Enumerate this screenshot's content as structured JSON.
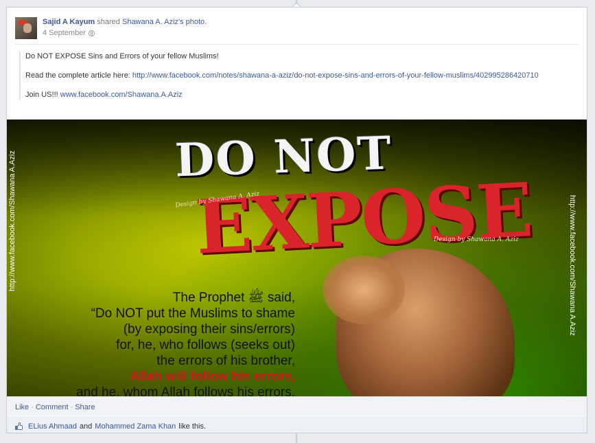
{
  "post": {
    "author": "Sajid A Kayum",
    "action_text": "shared",
    "owner_link": "Shawana A. Aziz",
    "owner_suffix": "'s photo.",
    "date": "4 September"
  },
  "message": {
    "line1": "Do NOT EXPOSE Sins and Errors of your fellow Muslims!",
    "line2_prefix": "Read the complete article here: ",
    "line2_link": "http://www.facebook.com/notes/shawana-a-aziz/do-not-expose-sins-and-errors-of-your-fellow-muslims/402995286420710",
    "line3_prefix": "Join US!!! ",
    "line3_link": "www.facebook.com/Shawana.A.Aziz"
  },
  "photo": {
    "title_top": "DO NOT",
    "title_main": "EXPOSE",
    "credit_left": "Design by Shawana A. Aziz",
    "credit_right": "Design by Shawana A. Aziz",
    "side_left": "http://www.facebook.com/Shawana A.Aziz",
    "side_right": "http://www.facebook.com/Shawana A.Aziz",
    "quote_lines": [
      "The Prophet ﷺ said,",
      "“Do NOT put the Muslims to shame",
      "(by exposing their sins/errors)",
      "for, he, who follows (seeks out)",
      "the errors of his brother,"
    ],
    "quote_red": "Allah will follow his errors,",
    "quote_last": "and he, whom Allah follows his errors,"
  },
  "actions": {
    "like": "Like",
    "comment": "Comment",
    "share": "Share",
    "sep": "·"
  },
  "likes": {
    "person1": "ELius Ahmaad",
    "and": "and",
    "person2": "Mohammed Zama Khan",
    "suffix": "like this."
  }
}
